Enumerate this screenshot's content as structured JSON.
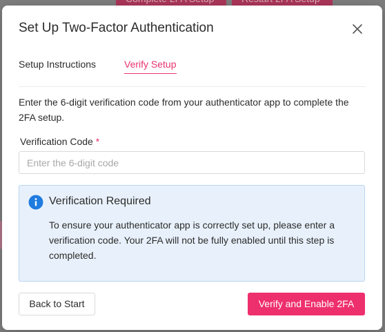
{
  "background": {
    "btn_complete": "Complete 2FA Setup",
    "btn_restart": "Restart 2FA Setup"
  },
  "dialog": {
    "title": "Set Up Two-Factor Authentication",
    "close_icon": "close-icon"
  },
  "tabs": [
    {
      "label": "Setup Instructions",
      "active": false
    },
    {
      "label": "Verify Setup",
      "active": true
    }
  ],
  "verify": {
    "description": "Enter the 6-digit verification code from your authenticator app to complete the 2FA setup.",
    "code_label": "Verification Code",
    "required_mark": "*",
    "code_placeholder": "Enter the 6-digit code",
    "code_value": ""
  },
  "alert": {
    "icon": "info-icon",
    "title": "Verification Required",
    "body": "To ensure your authenticator app is correctly set up, please enter a verification code. Your 2FA will not be fully enabled until this step is completed."
  },
  "footer": {
    "back_label": "Back to Start",
    "verify_label": "Verify and Enable 2FA"
  },
  "colors": {
    "accent": "#ee2f6e",
    "info": "#1f7ce0",
    "info_bg": "#e8f1fb"
  }
}
